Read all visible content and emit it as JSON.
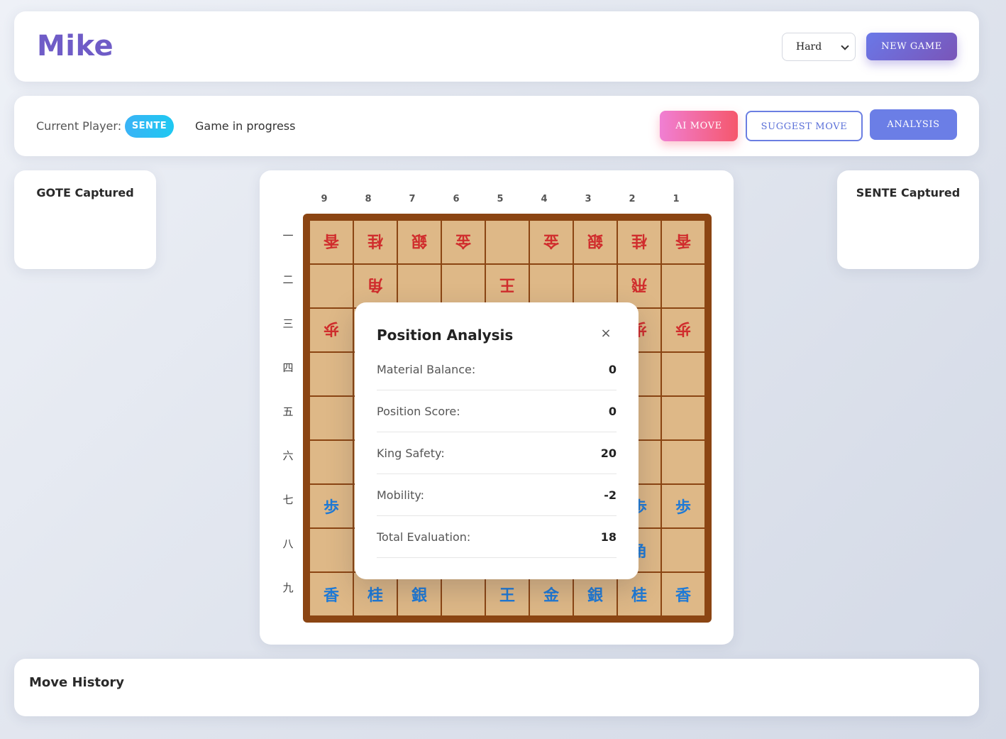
{
  "header": {
    "title": "Mike",
    "difficulty": "Hard",
    "new_game_label": "NEW GAME"
  },
  "status": {
    "current_player_label": "Current Player:",
    "current_player": "SENTE",
    "game_status": "Game in progress",
    "ai_move_label": "AI MOVE",
    "suggest_move_label": "SUGGEST MOVE",
    "analysis_label": "ANALYSIS"
  },
  "captured": {
    "gote_title": "GOTE Captured",
    "sente_title": "SENTE Captured"
  },
  "board": {
    "files": [
      "9",
      "8",
      "7",
      "6",
      "5",
      "4",
      "3",
      "2",
      "1"
    ],
    "ranks": [
      "一",
      "二",
      "三",
      "四",
      "五",
      "六",
      "七",
      "八",
      "九"
    ],
    "rows": [
      [
        {
          "p": "香",
          "o": "gote"
        },
        {
          "p": "桂",
          "o": "gote"
        },
        {
          "p": "銀",
          "o": "gote"
        },
        {
          "p": "金",
          "o": "gote"
        },
        {
          "p": "",
          "o": ""
        },
        {
          "p": "金",
          "o": "gote"
        },
        {
          "p": "銀",
          "o": "gote"
        },
        {
          "p": "桂",
          "o": "gote"
        },
        {
          "p": "香",
          "o": "gote"
        }
      ],
      [
        {
          "p": "",
          "o": ""
        },
        {
          "p": "角",
          "o": "gote"
        },
        {
          "p": "",
          "o": ""
        },
        {
          "p": "",
          "o": ""
        },
        {
          "p": "王",
          "o": "gote"
        },
        {
          "p": "",
          "o": ""
        },
        {
          "p": "",
          "o": ""
        },
        {
          "p": "飛",
          "o": "gote"
        },
        {
          "p": "",
          "o": ""
        }
      ],
      [
        {
          "p": "歩",
          "o": "gote"
        },
        {
          "p": "",
          "o": ""
        },
        {
          "p": "",
          "o": ""
        },
        {
          "p": "",
          "o": ""
        },
        {
          "p": "",
          "o": ""
        },
        {
          "p": "",
          "o": ""
        },
        {
          "p": "",
          "o": ""
        },
        {
          "p": "歩",
          "o": "gote"
        },
        {
          "p": "歩",
          "o": "gote"
        }
      ],
      [
        {
          "p": "",
          "o": ""
        },
        {
          "p": "",
          "o": ""
        },
        {
          "p": "",
          "o": ""
        },
        {
          "p": "",
          "o": ""
        },
        {
          "p": "",
          "o": ""
        },
        {
          "p": "",
          "o": ""
        },
        {
          "p": "",
          "o": ""
        },
        {
          "p": "",
          "o": ""
        },
        {
          "p": "",
          "o": ""
        }
      ],
      [
        {
          "p": "",
          "o": ""
        },
        {
          "p": "",
          "o": ""
        },
        {
          "p": "",
          "o": ""
        },
        {
          "p": "",
          "o": ""
        },
        {
          "p": "",
          "o": ""
        },
        {
          "p": "",
          "o": ""
        },
        {
          "p": "",
          "o": ""
        },
        {
          "p": "",
          "o": ""
        },
        {
          "p": "",
          "o": ""
        }
      ],
      [
        {
          "p": "",
          "o": ""
        },
        {
          "p": "",
          "o": ""
        },
        {
          "p": "",
          "o": ""
        },
        {
          "p": "",
          "o": ""
        },
        {
          "p": "",
          "o": ""
        },
        {
          "p": "",
          "o": ""
        },
        {
          "p": "",
          "o": ""
        },
        {
          "p": "",
          "o": ""
        },
        {
          "p": "",
          "o": ""
        }
      ],
      [
        {
          "p": "歩",
          "o": "sente"
        },
        {
          "p": "",
          "o": ""
        },
        {
          "p": "",
          "o": ""
        },
        {
          "p": "",
          "o": ""
        },
        {
          "p": "",
          "o": ""
        },
        {
          "p": "",
          "o": ""
        },
        {
          "p": "",
          "o": ""
        },
        {
          "p": "歩",
          "o": "sente"
        },
        {
          "p": "歩",
          "o": "sente"
        }
      ],
      [
        {
          "p": "",
          "o": ""
        },
        {
          "p": "",
          "o": ""
        },
        {
          "p": "",
          "o": ""
        },
        {
          "p": "",
          "o": ""
        },
        {
          "p": "",
          "o": ""
        },
        {
          "p": "",
          "o": ""
        },
        {
          "p": "",
          "o": ""
        },
        {
          "p": "角",
          "o": "sente"
        },
        {
          "p": "",
          "o": ""
        }
      ],
      [
        {
          "p": "香",
          "o": "sente"
        },
        {
          "p": "桂",
          "o": "sente"
        },
        {
          "p": "銀",
          "o": "sente"
        },
        {
          "p": "",
          "o": ""
        },
        {
          "p": "王",
          "o": "sente"
        },
        {
          "p": "金",
          "o": "sente"
        },
        {
          "p": "銀",
          "o": "sente"
        },
        {
          "p": "桂",
          "o": "sente"
        },
        {
          "p": "香",
          "o": "sente"
        }
      ]
    ]
  },
  "analysis": {
    "title": "Position Analysis",
    "close_icon": "×",
    "rows": [
      {
        "label": "Material Balance:",
        "value": "0"
      },
      {
        "label": "Position Score:",
        "value": "0"
      },
      {
        "label": "King Safety:",
        "value": "20"
      },
      {
        "label": "Mobility:",
        "value": "-2"
      },
      {
        "label": "Total Evaluation:",
        "value": "18"
      }
    ]
  },
  "history": {
    "title": "Move History"
  }
}
